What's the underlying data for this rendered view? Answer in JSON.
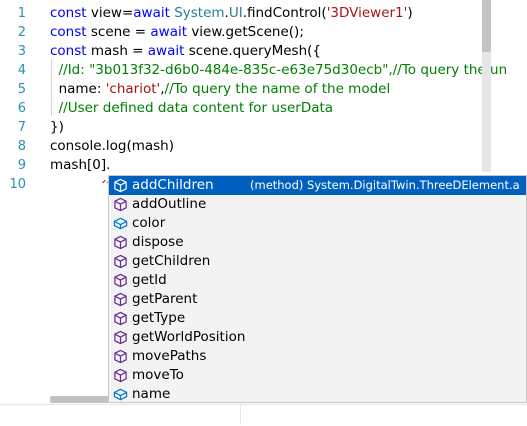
{
  "editor": {
    "line_numbers": [
      "1",
      "2",
      "3",
      "4",
      "5",
      "6",
      "7",
      "8",
      "9",
      "10"
    ],
    "lines": [
      [
        {
          "t": "kw",
          "v": "const "
        },
        {
          "t": "txt",
          "v": "view="
        },
        {
          "t": "kw",
          "v": "await "
        },
        {
          "t": "ty",
          "v": "System"
        },
        {
          "t": "txt",
          "v": "."
        },
        {
          "t": "ty",
          "v": "UI"
        },
        {
          "t": "txt",
          "v": ".findControl("
        },
        {
          "t": "str",
          "v": "'3DViewer1'"
        },
        {
          "t": "txt",
          "v": ")"
        }
      ],
      [
        {
          "t": "kw",
          "v": "const "
        },
        {
          "t": "txt",
          "v": "scene = "
        },
        {
          "t": "kw",
          "v": "await "
        },
        {
          "t": "txt",
          "v": "view.getScene();"
        }
      ],
      [
        {
          "t": "kw",
          "v": "const "
        },
        {
          "t": "txt",
          "v": "mash = "
        },
        {
          "t": "kw",
          "v": "await "
        },
        {
          "t": "txt",
          "v": "scene.queryMesh({"
        }
      ],
      [
        {
          "t": "txt",
          "v": "  "
        },
        {
          "t": "cmt",
          "v": "//Id: \"3b013f32-d6b0-484e-835c-e63e75d30ecb\",//To query the un"
        }
      ],
      [
        {
          "t": "txt",
          "v": "  name: "
        },
        {
          "t": "str",
          "v": "'chariot'"
        },
        {
          "t": "txt",
          "v": ","
        },
        {
          "t": "cmt",
          "v": "//To query the name of the model"
        }
      ],
      [
        {
          "t": "txt",
          "v": "  "
        },
        {
          "t": "cmt",
          "v": "//User defined data content for userData"
        }
      ],
      [
        {
          "t": "txt",
          "v": "})"
        }
      ],
      [
        {
          "t": "txt",
          "v": "console.log(mash)"
        }
      ],
      [
        {
          "t": "txt",
          "v": "mash[0]."
        }
      ],
      []
    ]
  },
  "suggest": {
    "items": [
      {
        "label": "addChildren",
        "icon": "method-cube-icon",
        "detail": "(method) System.DigitalTwin.ThreeDElement.a…",
        "selected": true
      },
      {
        "label": "addOutline",
        "icon": "method-cube-icon"
      },
      {
        "label": "color",
        "icon": "property-icon"
      },
      {
        "label": "dispose",
        "icon": "method-cube-icon"
      },
      {
        "label": "getChildren",
        "icon": "method-cube-icon"
      },
      {
        "label": "getId",
        "icon": "method-cube-icon"
      },
      {
        "label": "getParent",
        "icon": "method-cube-icon"
      },
      {
        "label": "getType",
        "icon": "method-cube-icon"
      },
      {
        "label": "getWorldPosition",
        "icon": "method-cube-icon"
      },
      {
        "label": "movePaths",
        "icon": "method-cube-icon"
      },
      {
        "label": "moveTo",
        "icon": "method-cube-icon"
      },
      {
        "label": "name",
        "icon": "property-icon"
      }
    ]
  },
  "colors": {
    "keyword": "#0000ff",
    "type": "#267f99",
    "string": "#a31515",
    "comment": "#008000",
    "selection": "#0060c0",
    "method_icon": "#652d90",
    "property_icon": "#007acc"
  }
}
